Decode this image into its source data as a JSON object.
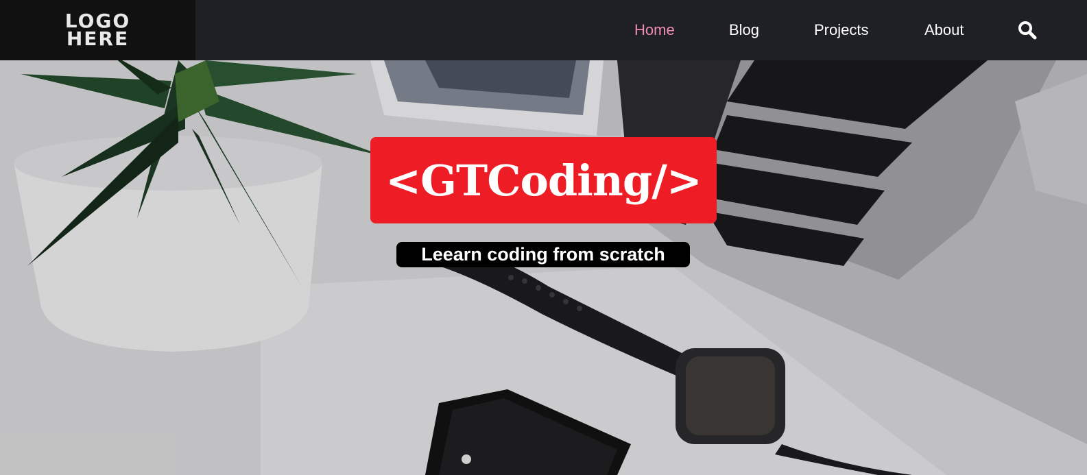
{
  "header": {
    "logo_line1": "LOGO",
    "logo_line2": "HERE",
    "nav": {
      "home": "Home",
      "blog": "Blog",
      "projects": "Projects",
      "about": "About"
    },
    "search_icon": "search-icon",
    "active_color": "#f08cb4"
  },
  "hero": {
    "title": "<GTCoding/>",
    "subtitle": "Leearn coding from scratch",
    "title_bg": "#ee1c24",
    "subtitle_bg": "#000000"
  }
}
